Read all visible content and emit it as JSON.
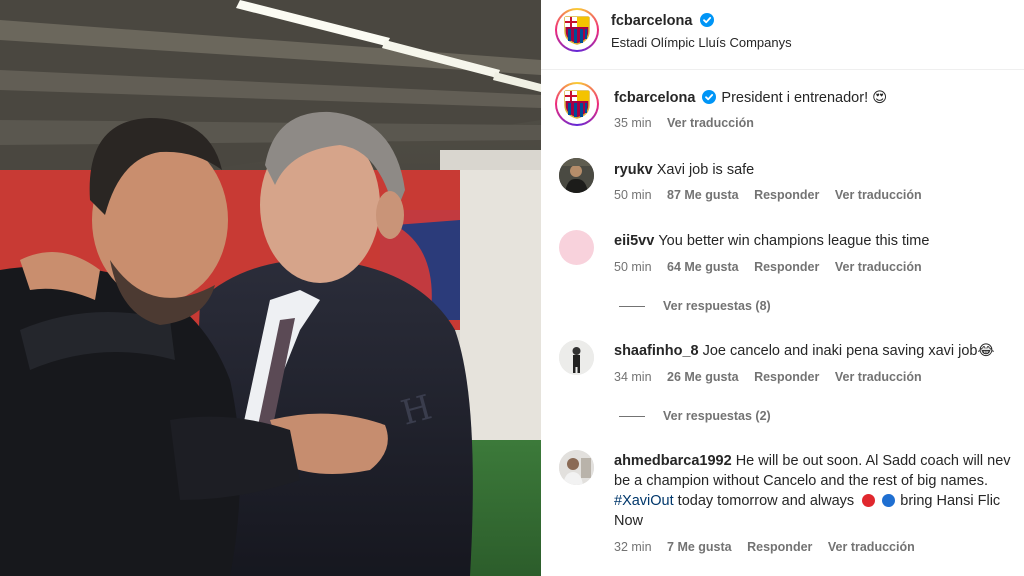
{
  "post": {
    "username": "fcbarcelona",
    "location": "Estadi Olímpic Lluís Companys",
    "verified": true,
    "photo_alt": "Xavi and Joan Laporta hugging"
  },
  "caption": {
    "username": "fcbarcelona",
    "text": "President i entrenador! 😍",
    "time": "35 min",
    "translate": "Ver traducción"
  },
  "comments": [
    {
      "username": "ryukv",
      "text": "Xavi job is safe",
      "time": "50 min",
      "likes": "87 Me gusta",
      "reply": "Responder",
      "translate": "Ver traducción"
    },
    {
      "username": "eii5vv",
      "text": "You better win champions league this time",
      "time": "50 min",
      "likes": "64 Me gusta",
      "reply": "Responder",
      "translate": "Ver traducción",
      "replies_label": "Ver respuestas (8)"
    },
    {
      "username": "shaafinho_8",
      "text": "Joe cancelo and inaki pena saving xavi job😂",
      "time": "34 min",
      "likes": "26 Me gusta",
      "reply": "Responder",
      "translate": "Ver traducción",
      "replies_label": "Ver respuestas (2)"
    },
    {
      "username": "ahmedbarca1992",
      "text_line1": "He will be out soon. Al Sadd coach will nev",
      "text_line2": "be a champion without Cancelo and the rest of big names.",
      "hashtag": "#XaviOut",
      "text_line3": " today tomorrow and always",
      "text_line3b": "bring Hansi Flic",
      "text_line4": "Now",
      "time": "32 min",
      "likes": "7 Me gusta",
      "reply": "Responder",
      "translate": "Ver traducción"
    }
  ],
  "colors": {
    "accent_link": "#00376b",
    "muted": "#737373",
    "verified": "#0095f6",
    "barca_blue": "#004d98",
    "barca_red": "#a50044"
  },
  "icons": [
    "verified-badge-icon",
    "heart-eyes-emoji",
    "laughing-emoji",
    "red-circle-emoji",
    "blue-circle-emoji"
  ]
}
